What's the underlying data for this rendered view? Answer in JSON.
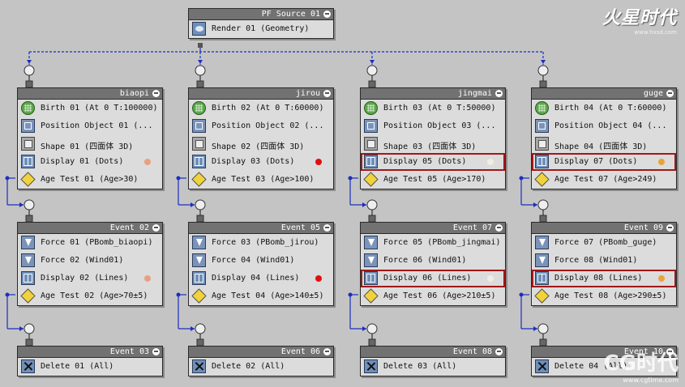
{
  "source": {
    "title": "PF Source 01",
    "operator": {
      "label": "Render 01 (Geometry)",
      "icon": "render-icon"
    }
  },
  "columns": [
    {
      "event": {
        "title": "biaopi",
        "ops": [
          {
            "label": "Birth 01 (At 0 T:100000)",
            "icon": "birth-icon"
          },
          {
            "label": "Position Object 01 (...",
            "icon": "position-object-icon"
          },
          {
            "label": "Shape 01 (四面体 3D)",
            "icon": "shape-icon"
          },
          {
            "label": "Display 01 (Dots)",
            "icon": "display-icon",
            "color": "#e9a07f"
          },
          {
            "label": "Age Test 01 (Age>30)",
            "icon": "age-test-icon"
          }
        ]
      },
      "event2": {
        "title": "Event 02",
        "ops": [
          {
            "label": "Force 01 (PBomb_biaopi)",
            "icon": "force-icon"
          },
          {
            "label": "Force 02 (Wind01)",
            "icon": "force-icon"
          },
          {
            "label": "Display 02 (Lines)",
            "icon": "display-icon",
            "color": "#e9a07f"
          },
          {
            "label": "Age Test 02 (Age>70±5)",
            "icon": "age-test-icon"
          }
        ]
      },
      "event3": {
        "title": "Event 03",
        "ops": [
          {
            "label": "Delete 01 (All)",
            "icon": "delete-icon"
          }
        ]
      }
    },
    {
      "event": {
        "title": "jirou",
        "ops": [
          {
            "label": "Birth 02 (At 0 T:60000)",
            "icon": "birth-icon"
          },
          {
            "label": "Position Object 02 (...",
            "icon": "position-object-icon"
          },
          {
            "label": "Shape 02 (四面体 3D)",
            "icon": "shape-icon"
          },
          {
            "label": "Display 03 (Dots)",
            "icon": "display-icon",
            "color": "#e01010"
          },
          {
            "label": "Age Test 03 (Age>100)",
            "icon": "age-test-icon"
          }
        ]
      },
      "event2": {
        "title": "Event 05",
        "ops": [
          {
            "label": "Force 03 (PBomb_jirou)",
            "icon": "force-icon"
          },
          {
            "label": "Force 04 (Wind01)",
            "icon": "force-icon"
          },
          {
            "label": "Display 04 (Lines)",
            "icon": "display-icon",
            "color": "#e01010"
          },
          {
            "label": "Age Test 04 (Age>140±5)",
            "icon": "age-test-icon"
          }
        ]
      },
      "event3": {
        "title": "Event 06",
        "ops": [
          {
            "label": "Delete 02 (All)",
            "icon": "delete-icon"
          }
        ]
      }
    },
    {
      "event": {
        "title": "jingmai",
        "ops": [
          {
            "label": "Birth 03 (At 0 T:50000)",
            "icon": "birth-icon"
          },
          {
            "label": "Position Object 03 (...",
            "icon": "position-object-icon"
          },
          {
            "label": "Shape 03 (四面体 3D)",
            "icon": "shape-icon"
          },
          {
            "label": "Display 05 (Dots)",
            "icon": "display-icon",
            "color": "#f2ece2",
            "highlighted": true
          },
          {
            "label": "Age Test 05 (Age>170)",
            "icon": "age-test-icon"
          }
        ]
      },
      "event2": {
        "title": "Event 07",
        "ops": [
          {
            "label": "Force 05 (PBomb_jingmai)",
            "icon": "force-icon"
          },
          {
            "label": "Force 06 (Wind01)",
            "icon": "force-icon"
          },
          {
            "label": "Display 06 (Lines)",
            "icon": "display-icon",
            "color": "#f2ece2",
            "highlighted": true
          },
          {
            "label": "Age Test 06 (Age>210±5)",
            "icon": "age-test-icon"
          }
        ]
      },
      "event3": {
        "title": "Event 08",
        "ops": [
          {
            "label": "Delete 03 (All)",
            "icon": "delete-icon"
          }
        ]
      }
    },
    {
      "event": {
        "title": "guge",
        "ops": [
          {
            "label": "Birth 04 (At 0 T:60000)",
            "icon": "birth-icon"
          },
          {
            "label": "Position Object 04 (...",
            "icon": "position-object-icon"
          },
          {
            "label": "Shape 04 (四面体 3D)",
            "icon": "shape-icon"
          },
          {
            "label": "Display 07 (Dots)",
            "icon": "display-icon",
            "color": "#e8a43a",
            "highlighted": true
          },
          {
            "label": "Age Test 07 (Age>249)",
            "icon": "age-test-icon"
          }
        ]
      },
      "event2": {
        "title": "Event 09",
        "ops": [
          {
            "label": "Force 07 (PBomb_guge)",
            "icon": "force-icon"
          },
          {
            "label": "Force 08 (Wind01)",
            "icon": "force-icon"
          },
          {
            "label": "Display 08 (Lines)",
            "icon": "display-icon",
            "color": "#e8a43a",
            "highlighted": true
          },
          {
            "label": "Age Test 08 (Age>290±5)",
            "icon": "age-test-icon"
          }
        ]
      },
      "event3": {
        "title": "Event 10",
        "ops": [
          {
            "label": "Delete 04 (All)",
            "icon": "delete-icon"
          }
        ]
      }
    }
  ],
  "watermarks": {
    "top_logo": "火星时代",
    "top_url": "www.hxsd.com",
    "bottom_logo": "CG时代",
    "bottom_url": "www.cgtime.com"
  },
  "colors": {
    "wire": "#1c2fbf",
    "highlight": "#a01818",
    "node_header": "#727272",
    "node_body": "#dcdcdc"
  }
}
